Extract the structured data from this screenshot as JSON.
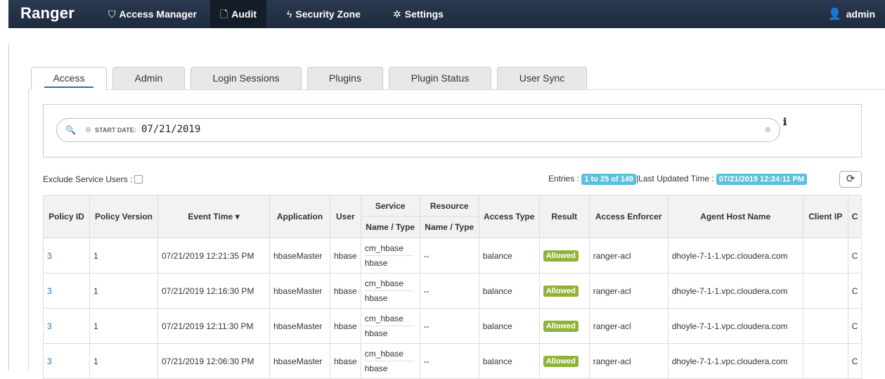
{
  "nav": {
    "brand": "Ranger",
    "items": [
      {
        "label": "Access Manager",
        "icon": "shield-icon"
      },
      {
        "label": "Audit",
        "icon": "file-icon"
      },
      {
        "label": "Security Zone",
        "icon": "lightning-icon"
      },
      {
        "label": "Settings",
        "icon": "gear-icon"
      }
    ],
    "user": "admin"
  },
  "tabs": [
    "Access",
    "Admin",
    "Login Sessions",
    "Plugins",
    "Plugin Status",
    "User Sync"
  ],
  "search": {
    "filter_label": "START DATE:",
    "filter_value": "07/21/2019"
  },
  "toolbar": {
    "exclude_label": "Exclude Service Users :",
    "entries_label": "Entries :",
    "entries_value": "1 to 25 of 149",
    "updated_label": "|Last Updated Time :",
    "updated_value": "07/21/2019 12:24:11 PM"
  },
  "table": {
    "headers": {
      "policy_id": "Policy ID",
      "policy_version": "Policy Version",
      "event_time": "Event Time",
      "application": "Application",
      "user": "User",
      "service": "Service",
      "service_sub": "Name / Type",
      "resource": "Resource",
      "resource_sub": "Name / Type",
      "access_type": "Access Type",
      "result": "Result",
      "access_enforcer": "Access Enforcer",
      "agent_host": "Agent Host Name",
      "client_ip": "Client IP",
      "cluster": "C"
    },
    "rows": [
      {
        "policy_id": "3",
        "version": "1",
        "time": "07/21/2019 12:21:35 PM",
        "app": "hbaseMaster",
        "user": "hbase",
        "svc_name": "cm_hbase",
        "svc_type": "hbase",
        "resource": "--",
        "access": "balance",
        "result": "Allowed",
        "enforcer": "ranger-acl",
        "host": "dhoyle-7-1-1.vpc.cloudera.com",
        "ip": "",
        "c": "C"
      },
      {
        "policy_id": "3",
        "version": "1",
        "time": "07/21/2019 12:16:30 PM",
        "app": "hbaseMaster",
        "user": "hbase",
        "svc_name": "cm_hbase",
        "svc_type": "hbase",
        "resource": "--",
        "access": "balance",
        "result": "Allowed",
        "enforcer": "ranger-acl",
        "host": "dhoyle-7-1-1.vpc.cloudera.com",
        "ip": "",
        "c": "C"
      },
      {
        "policy_id": "3",
        "version": "1",
        "time": "07/21/2019 12:11:30 PM",
        "app": "hbaseMaster",
        "user": "hbase",
        "svc_name": "cm_hbase",
        "svc_type": "hbase",
        "resource": "--",
        "access": "balance",
        "result": "Allowed",
        "enforcer": "ranger-acl",
        "host": "dhoyle-7-1-1.vpc.cloudera.com",
        "ip": "",
        "c": "C"
      },
      {
        "policy_id": "3",
        "version": "1",
        "time": "07/21/2019 12:06:30 PM",
        "app": "hbaseMaster",
        "user": "hbase",
        "svc_name": "cm_hbase",
        "svc_type": "hbase",
        "resource": "--",
        "access": "balance",
        "result": "Allowed",
        "enforcer": "ranger-acl",
        "host": "dhoyle-7-1-1.vpc.cloudera.com",
        "ip": "",
        "c": "C"
      }
    ]
  }
}
